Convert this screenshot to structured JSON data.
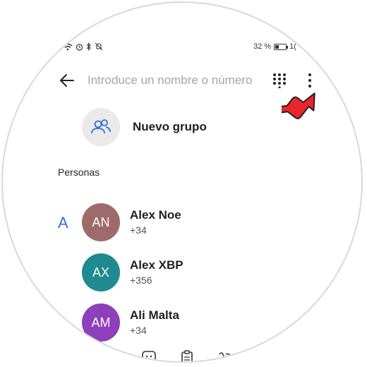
{
  "status_bar": {
    "battery_text": "32 %",
    "time_partial": "1(",
    "battery_level": 0.32
  },
  "search": {
    "placeholder": "Introduce un nombre o número"
  },
  "new_group": {
    "label": "Nuevo grupo"
  },
  "section": {
    "title": "Personas"
  },
  "index_letter": "A",
  "contacts": [
    {
      "initials": "AN",
      "name": "Alex Noe",
      "number": "+34 ",
      "color": "#9e6b6b"
    },
    {
      "initials": "AX",
      "name": "Alex XBP",
      "number": "+356 ",
      "color": "#1f8a8f"
    },
    {
      "initials": "AM",
      "name": "Ali Malta",
      "number": "+34 ",
      "color": "#8e3fbb"
    }
  ],
  "icons": {
    "back": "arrow-left-icon",
    "dialpad": "dialpad-icon",
    "more": "more-vertical-icon",
    "pointer": "red-pointer-arrow",
    "group": "group-icon"
  },
  "colors": {
    "accent": "#2e6fd6",
    "pointer_red": "#e8262c"
  }
}
